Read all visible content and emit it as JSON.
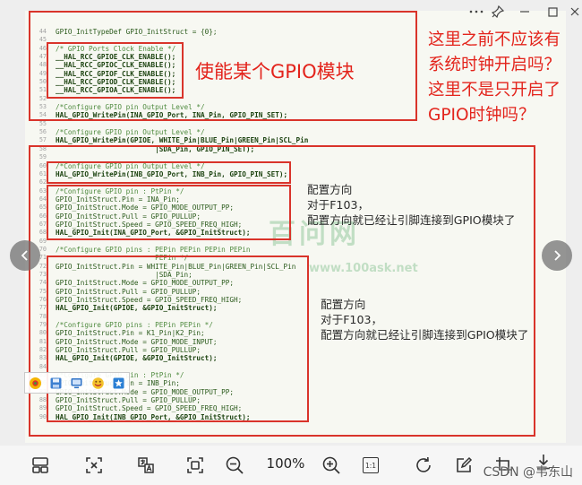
{
  "window": {
    "controls": [
      "more-icon",
      "pin-icon",
      "minimize-icon",
      "maximize-icon",
      "close-icon"
    ]
  },
  "colors": {
    "annotation_red": "#e3241c",
    "box_red": "#d9342b",
    "comment_green": "#4e8a3e",
    "code_green": "#2a5a1b",
    "watermark_green": "#3a9d4f"
  },
  "annotations": {
    "enable_label": "使能某个GPIO模块",
    "question_lines": [
      "这里之前不应该有",
      "系统时钟开启吗？",
      "这里不是只开启了",
      "GPIO时钟吗？"
    ],
    "note1_lines": [
      "配置方向",
      "对于F103，",
      "配置方向就已经让引脚连接到GPIO模块了"
    ],
    "note2_lines": [
      "配置方向",
      "对于F103，",
      "配置方向就已经让引脚连接到GPIO模块了"
    ]
  },
  "watermark": {
    "logo": "百问网",
    "url": "www.100ask.net"
  },
  "code_lines": [
    {
      "n": "44",
      "text": "GPIO_InitTypeDef GPIO_InitStruct = {0};",
      "style": "code"
    },
    {
      "n": "45",
      "text": "",
      "style": "code"
    },
    {
      "n": "46",
      "text": "/* GPIO Ports Clock Enable */",
      "style": "comment"
    },
    {
      "n": "47",
      "text": "__HAL_RCC_GPIOE_CLK_ENABLE();",
      "style": "call"
    },
    {
      "n": "48",
      "text": "__HAL_RCC_GPIOC_CLK_ENABLE();",
      "style": "call"
    },
    {
      "n": "49",
      "text": "__HAL_RCC_GPIOF_CLK_ENABLE();",
      "style": "call"
    },
    {
      "n": "50",
      "text": "__HAL_RCC_GPIOD_CLK_ENABLE();",
      "style": "call"
    },
    {
      "n": "51",
      "text": "__HAL_RCC_GPIOA_CLK_ENABLE();",
      "style": "call"
    },
    {
      "n": "52",
      "text": "",
      "style": "code"
    },
    {
      "n": "53",
      "text": "/*Configure GPIO pin Output Level */",
      "style": "comment"
    },
    {
      "n": "54",
      "text": "HAL_GPIO_WritePin(INA_GPIO_Port, INA_Pin, GPIO_PIN_SET);",
      "style": "call"
    },
    {
      "n": "55",
      "text": "",
      "style": "code"
    },
    {
      "n": "56",
      "text": "/*Configure GPIO pin Output Level */",
      "style": "comment"
    },
    {
      "n": "57",
      "text": "HAL_GPIO_WritePin(GPIOE, WHITE_Pin|BLUE_Pin|GREEN_Pin|SCL_Pin",
      "style": "call"
    },
    {
      "n": "58",
      "text": "                        |SDA_Pin, GPIO_PIN_SET);",
      "style": "call"
    },
    {
      "n": "59",
      "text": "",
      "style": "code"
    },
    {
      "n": "60",
      "text": "/*Configure GPIO pin Output Level */",
      "style": "comment"
    },
    {
      "n": "61",
      "text": "HAL_GPIO_WritePin(INB_GPIO_Port, INB_Pin, GPIO_PIN_SET);",
      "style": "call"
    },
    {
      "n": "62",
      "text": "",
      "style": "code"
    },
    {
      "n": "63",
      "text": "/*Configure GPIO pin : PtPin */",
      "style": "comment"
    },
    {
      "n": "64",
      "text": "GPIO_InitStruct.Pin = INA_Pin;",
      "style": "code"
    },
    {
      "n": "65",
      "text": "GPIO_InitStruct.Mode = GPIO_MODE_OUTPUT_PP;",
      "style": "code"
    },
    {
      "n": "66",
      "text": "GPIO_InitStruct.Pull = GPIO_PULLUP;",
      "style": "code"
    },
    {
      "n": "67",
      "text": "GPIO_InitStruct.Speed = GPIO_SPEED_FREQ_HIGH;",
      "style": "code"
    },
    {
      "n": "68",
      "text": "HAL_GPIO_Init(INA_GPIO_Port, &GPIO_InitStruct);",
      "style": "call"
    },
    {
      "n": "69",
      "text": "",
      "style": "code"
    },
    {
      "n": "70",
      "text": "/*Configure GPIO pins : PEPin PEPin PEPin PEPin",
      "style": "comment"
    },
    {
      "n": "71",
      "text": "                        PEPin */",
      "style": "comment"
    },
    {
      "n": "72",
      "text": "GPIO_InitStruct.Pin = WHITE_Pin|BLUE_Pin|GREEN_Pin|SCL_Pin",
      "style": "code"
    },
    {
      "n": "73",
      "text": "                        |SDA_Pin;",
      "style": "code"
    },
    {
      "n": "74",
      "text": "GPIO_InitStruct.Mode = GPIO_MODE_OUTPUT_PP;",
      "style": "code"
    },
    {
      "n": "75",
      "text": "GPIO_InitStruct.Pull = GPIO_PULLUP;",
      "style": "code"
    },
    {
      "n": "76",
      "text": "GPIO_InitStruct.Speed = GPIO_SPEED_FREQ_HIGH;",
      "style": "code"
    },
    {
      "n": "77",
      "text": "HAL_GPIO_Init(GPIOE, &GPIO_InitStruct);",
      "style": "call"
    },
    {
      "n": "78",
      "text": "",
      "style": "code"
    },
    {
      "n": "79",
      "text": "/*Configure GPIO pins : PEPin PEPin */",
      "style": "comment"
    },
    {
      "n": "80",
      "text": "GPIO_InitStruct.Pin = K1_Pin|K2_Pin;",
      "style": "code"
    },
    {
      "n": "81",
      "text": "GPIO_InitStruct.Mode = GPIO_MODE_INPUT;",
      "style": "code"
    },
    {
      "n": "82",
      "text": "GPIO_InitStruct.Pull = GPIO_PULLUP;",
      "style": "code"
    },
    {
      "n": "83",
      "text": "HAL_GPIO_Init(GPIOE, &GPIO_InitStruct);",
      "style": "call"
    },
    {
      "n": "84",
      "text": "",
      "style": "code"
    },
    {
      "n": "85",
      "text": "/*Configure GPIO pin : PtPin */",
      "style": "comment"
    },
    {
      "n": "86",
      "text": "GPIO_InitStruct.Pin = INB_Pin;",
      "style": "code"
    },
    {
      "n": "87",
      "text": "GPIO_InitStruct.Mode = GPIO_MODE_OUTPUT_PP;",
      "style": "code"
    },
    {
      "n": "88",
      "text": "GPIO_InitStruct.Pull = GPIO_PULLUP;",
      "style": "code"
    },
    {
      "n": "89",
      "text": "GPIO_InitStruct.Speed = GPIO_SPEED_FREQ_HIGH;",
      "style": "code"
    },
    {
      "n": "90",
      "text": "HAL_GPIO_Init(INB_GPIO_Port, &GPIO_InitStruct);",
      "style": "call"
    }
  ],
  "float_toolbar": {
    "icons": [
      "wechat-icon",
      "save-icon",
      "screen-icon",
      "sticker-icon",
      "bookmark-icon"
    ]
  },
  "toolbar": {
    "icons": [
      "layout-icon",
      "extract-icon",
      "translate-icon",
      "fit-window-icon",
      "zoom-out-icon",
      "zoom-in-icon",
      "actual-size-icon",
      "rotate-icon",
      "edit-icon",
      "crop-icon",
      "download-icon"
    ],
    "zoom": "100%",
    "actual_size_label": "1:1",
    "credit": "CSDN @韦东山"
  }
}
